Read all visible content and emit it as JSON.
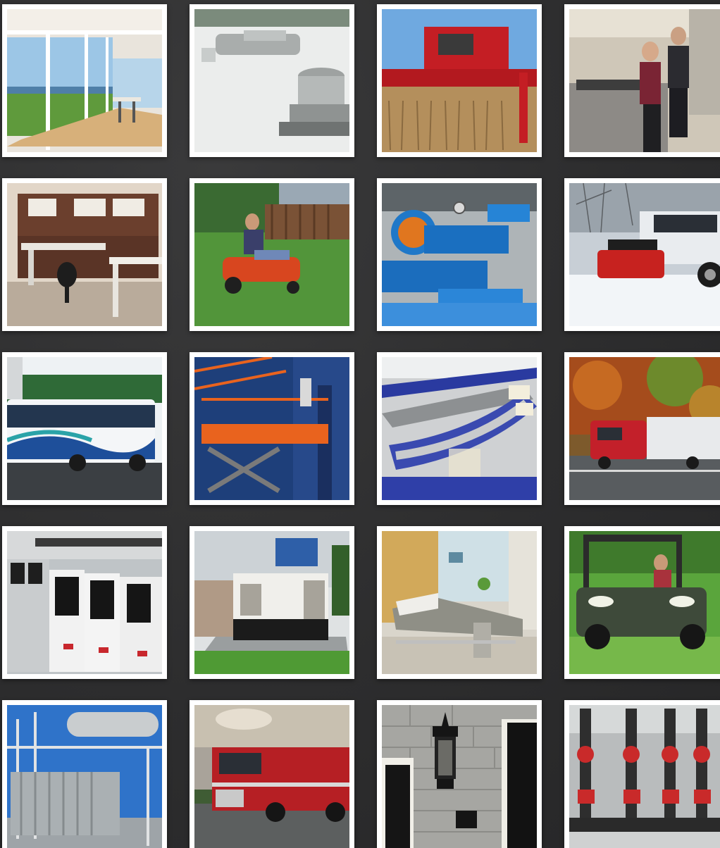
{
  "gallery": {
    "tiles": [
      {
        "subject": "sunroom-interior"
      },
      {
        "subject": "rooftop-hvac-units"
      },
      {
        "subject": "combine-harvester"
      },
      {
        "subject": "kitchen-couple"
      },
      {
        "subject": "office-furniture"
      },
      {
        "subject": "zero-turn-mower"
      },
      {
        "subject": "industrial-pumps"
      },
      {
        "subject": "snow-plow-truck"
      },
      {
        "subject": "transit-bus"
      },
      {
        "subject": "scissor-lift"
      },
      {
        "subject": "conveyor-system"
      },
      {
        "subject": "semi-truck"
      },
      {
        "subject": "drive-cabinets"
      },
      {
        "subject": "backup-generator"
      },
      {
        "subject": "hospital-bed"
      },
      {
        "subject": "utility-vehicle"
      },
      {
        "subject": "electrical-substation"
      },
      {
        "subject": "fire-engine"
      },
      {
        "subject": "wall-lantern"
      },
      {
        "subject": "sprinkler-valves"
      }
    ]
  }
}
